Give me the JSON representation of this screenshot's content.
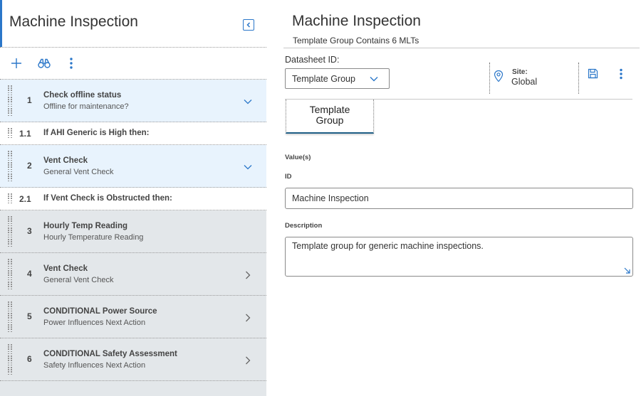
{
  "left_panel": {
    "title": "Machine Inspection",
    "toolbar": {
      "add_icon": "plus-icon",
      "search_icon": "binoculars-icon",
      "more_icon": "kebab-icon"
    },
    "steps": [
      {
        "number": "1",
        "title": "Check offline status",
        "subtitle": "Offline for maintenance?",
        "style": "highlight",
        "chevron": "down"
      },
      {
        "number": "1.1",
        "title": "If AHI Generic is High then:",
        "style": "cond"
      },
      {
        "number": "2",
        "title": "Vent Check",
        "subtitle": "General Vent Check",
        "style": "highlight",
        "chevron": "down"
      },
      {
        "number": "2.1",
        "title": "If Vent Check is Obstructed then:",
        "style": "cond"
      },
      {
        "number": "3",
        "title": "Hourly Temp Reading",
        "subtitle": "Hourly Temperature Reading",
        "style": "gray",
        "chevron": "none"
      },
      {
        "number": "4",
        "title": "Vent Check",
        "subtitle": "General Vent Check",
        "style": "gray",
        "chevron": "right"
      },
      {
        "number": "5",
        "title": "CONDITIONAL Power Source",
        "subtitle": "Power Influences Next Action",
        "style": "gray",
        "chevron": "right"
      },
      {
        "number": "6",
        "title": "CONDITIONAL Safety Assessment",
        "subtitle": "Safety Influences Next Action",
        "style": "gray",
        "chevron": "right"
      }
    ]
  },
  "right_panel": {
    "title": "Machine Inspection",
    "subtitle": "Template Group Contains 6 MLTs",
    "datasheet_label": "Datasheet ID:",
    "datasheet_value": "Template Group",
    "site_label": "Site:",
    "site_value": "Global",
    "tab_label_line1": "Template",
    "tab_label_line2": "Group",
    "values_label": "Value(s)",
    "id_label": "ID",
    "id_value": "Machine Inspection",
    "description_label": "Description",
    "description_value": "Template group for generic machine inspections."
  },
  "colors": {
    "accent": "#2b77c9",
    "highlight_row": "#e8f3fd",
    "gray_row": "#e3e7ea",
    "tab_underline": "#1f5e86"
  }
}
